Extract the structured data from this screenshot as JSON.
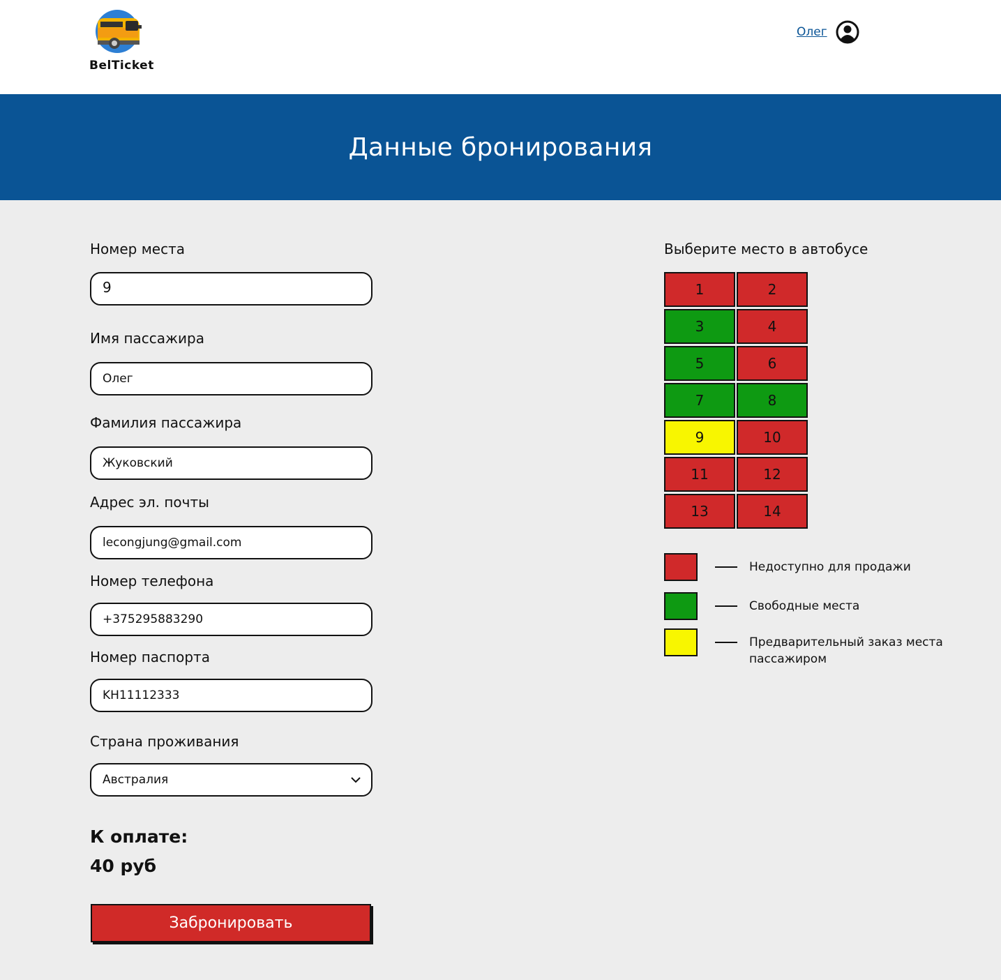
{
  "header": {
    "brand": "BelTicket",
    "user_name": "Олег"
  },
  "banner": {
    "title": "Данные бронирования"
  },
  "form": {
    "seat_label": "Номер места",
    "seat_value": "9",
    "first_name_label": "Имя пассажира",
    "first_name_value": "Олег",
    "last_name_label": "Фамилия пассажира",
    "last_name_value": "Жуковский",
    "email_label": "Адрес эл. почты",
    "email_value": "lecongjung@gmail.com",
    "phone_label": "Номер телефона",
    "phone_value": "+375295883290",
    "passport_label": "Номер паспорта",
    "passport_value": "KH11112333",
    "country_label": "Страна проживания",
    "country_value": "Австралия"
  },
  "payment": {
    "label": "К оплате:",
    "amount": "40 руб"
  },
  "book_button": "Забронировать",
  "seat_map": {
    "title": "Выберите место в автобусе",
    "seats": [
      {
        "number": "1",
        "status": "unavailable"
      },
      {
        "number": "2",
        "status": "unavailable"
      },
      {
        "number": "3",
        "status": "free"
      },
      {
        "number": "4",
        "status": "unavailable"
      },
      {
        "number": "5",
        "status": "free"
      },
      {
        "number": "6",
        "status": "unavailable"
      },
      {
        "number": "7",
        "status": "free"
      },
      {
        "number": "8",
        "status": "free"
      },
      {
        "number": "9",
        "status": "reserved"
      },
      {
        "number": "10",
        "status": "unavailable"
      },
      {
        "number": "11",
        "status": "unavailable"
      },
      {
        "number": "12",
        "status": "unavailable"
      },
      {
        "number": "13",
        "status": "unavailable"
      },
      {
        "number": "14",
        "status": "unavailable"
      }
    ]
  },
  "legend": [
    {
      "status": "unavailable",
      "text": "Недоступно для продажи"
    },
    {
      "status": "free",
      "text": "Свободные места"
    },
    {
      "status": "reserved",
      "text": "Предварительный заказ места пассажиром"
    }
  ],
  "colors": {
    "unavailable": "#d0292a",
    "free": "#0e9a12",
    "reserved": "#f8f600",
    "banner": "#0a5495",
    "button": "#d02a28"
  }
}
